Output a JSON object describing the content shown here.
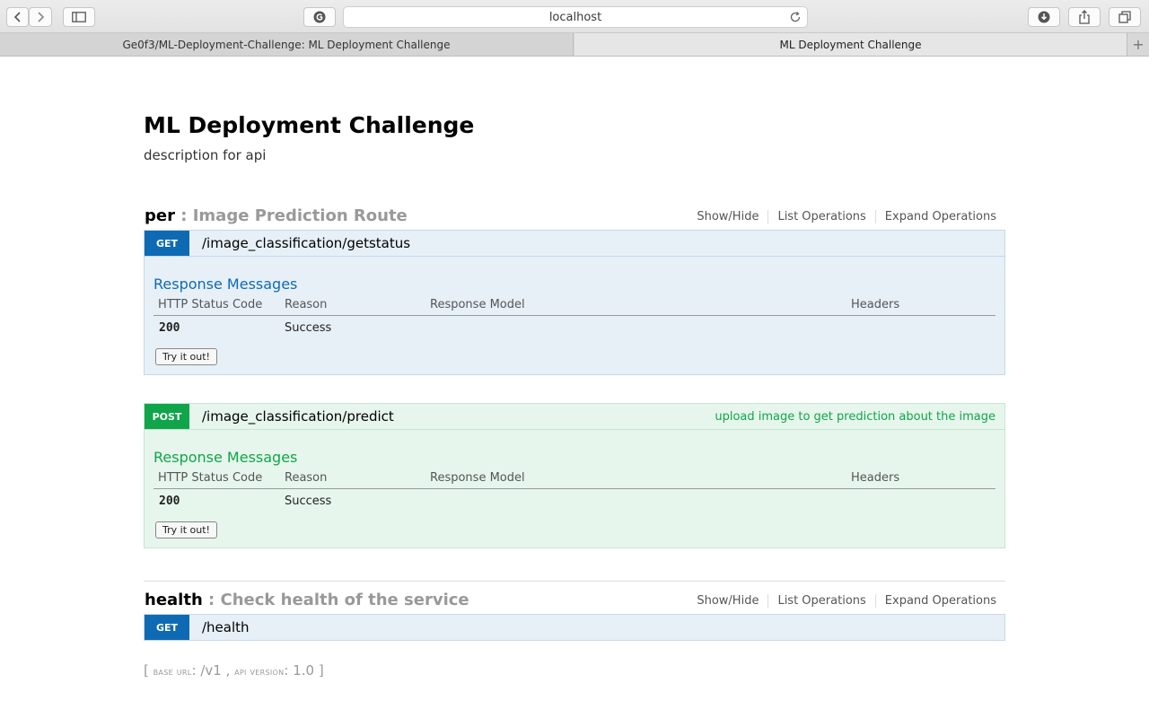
{
  "browser": {
    "url": "localhost",
    "tabs": [
      {
        "label": "Ge0f3/ML-Deployment-Challenge: ML Deployment Challenge"
      },
      {
        "label": "ML Deployment Challenge"
      }
    ]
  },
  "api": {
    "title": "ML Deployment Challenge",
    "description": "description for api"
  },
  "resources": [
    {
      "name": "per",
      "description": ": Image Prediction Route",
      "links": [
        "Show/Hide",
        "List Operations",
        "Expand Operations"
      ],
      "operations": [
        {
          "method": "GET",
          "path": "/image_classification/getstatus",
          "summary": "",
          "response_title": "Response Messages",
          "columns": [
            "HTTP Status Code",
            "Reason",
            "Response Model",
            "Headers"
          ],
          "rows": [
            {
              "code": "200",
              "reason": "Success"
            }
          ],
          "try_label": "Try it out!"
        },
        {
          "method": "POST",
          "path": "/image_classification/predict",
          "summary": "upload image to get prediction about the image",
          "response_title": "Response Messages",
          "columns": [
            "HTTP Status Code",
            "Reason",
            "Response Model",
            "Headers"
          ],
          "rows": [
            {
              "code": "200",
              "reason": "Success"
            }
          ],
          "try_label": "Try it out!"
        }
      ]
    },
    {
      "name": "health",
      "description": ": Check health of the service",
      "links": [
        "Show/Hide",
        "List Operations",
        "Expand Operations"
      ],
      "operations": [
        {
          "method": "GET",
          "path": "/health"
        }
      ]
    }
  ],
  "footer": {
    "open": "[",
    "base_url_label": "base url",
    "base_url": ": /v1 ,",
    "api_version_label": "api version",
    "api_version": ": 1.0 ]"
  }
}
